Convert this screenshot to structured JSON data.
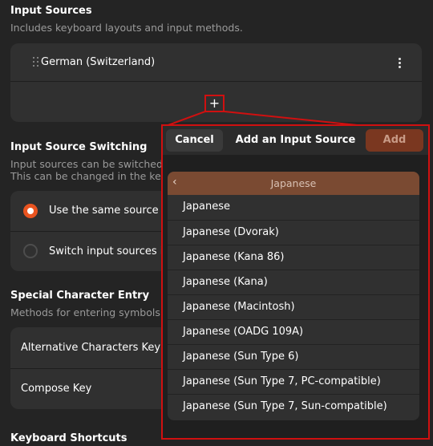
{
  "input_sources": {
    "title": "Input Sources",
    "description": "Includes keyboard layouts and input methods.",
    "items": [
      "German (Switzerland)"
    ],
    "add_symbol": "+"
  },
  "switching": {
    "title": "Input Source Switching",
    "description_line1": "Input sources can be switched",
    "description_line2": "This can be changed in the keyb",
    "option_same": "Use the same source fo",
    "option_window": "Switch input sources in"
  },
  "special_chars": {
    "title": "Special Character Entry",
    "description": "Methods for entering symbols",
    "alt_chars": "Alternative Characters Key",
    "compose": "Compose Key"
  },
  "shortcuts": {
    "title": "Keyboard Shortcuts"
  },
  "dialog": {
    "cancel_label": "Cancel",
    "title": "Add an Input Source",
    "add_label": "Add",
    "list_header": "Japanese",
    "items": [
      "Japanese",
      "Japanese (Dvorak)",
      "Japanese (Kana 86)",
      "Japanese (Kana)",
      "Japanese (Macintosh)",
      "Japanese (OADG 109A)",
      "Japanese (Sun Type 6)",
      "Japanese (Sun Type 7, PC-compatible)",
      "Japanese (Sun Type 7, Sun-compatible)"
    ]
  },
  "colors": {
    "accent": "#e95420",
    "highlight_border": "#d01010",
    "background": "#242424",
    "card": "#303030"
  },
  "icons": {
    "drag": "drag-handle-icon",
    "menu": "kebab-menu-icon",
    "add": "plus-icon",
    "back": "chevron-left-icon"
  }
}
